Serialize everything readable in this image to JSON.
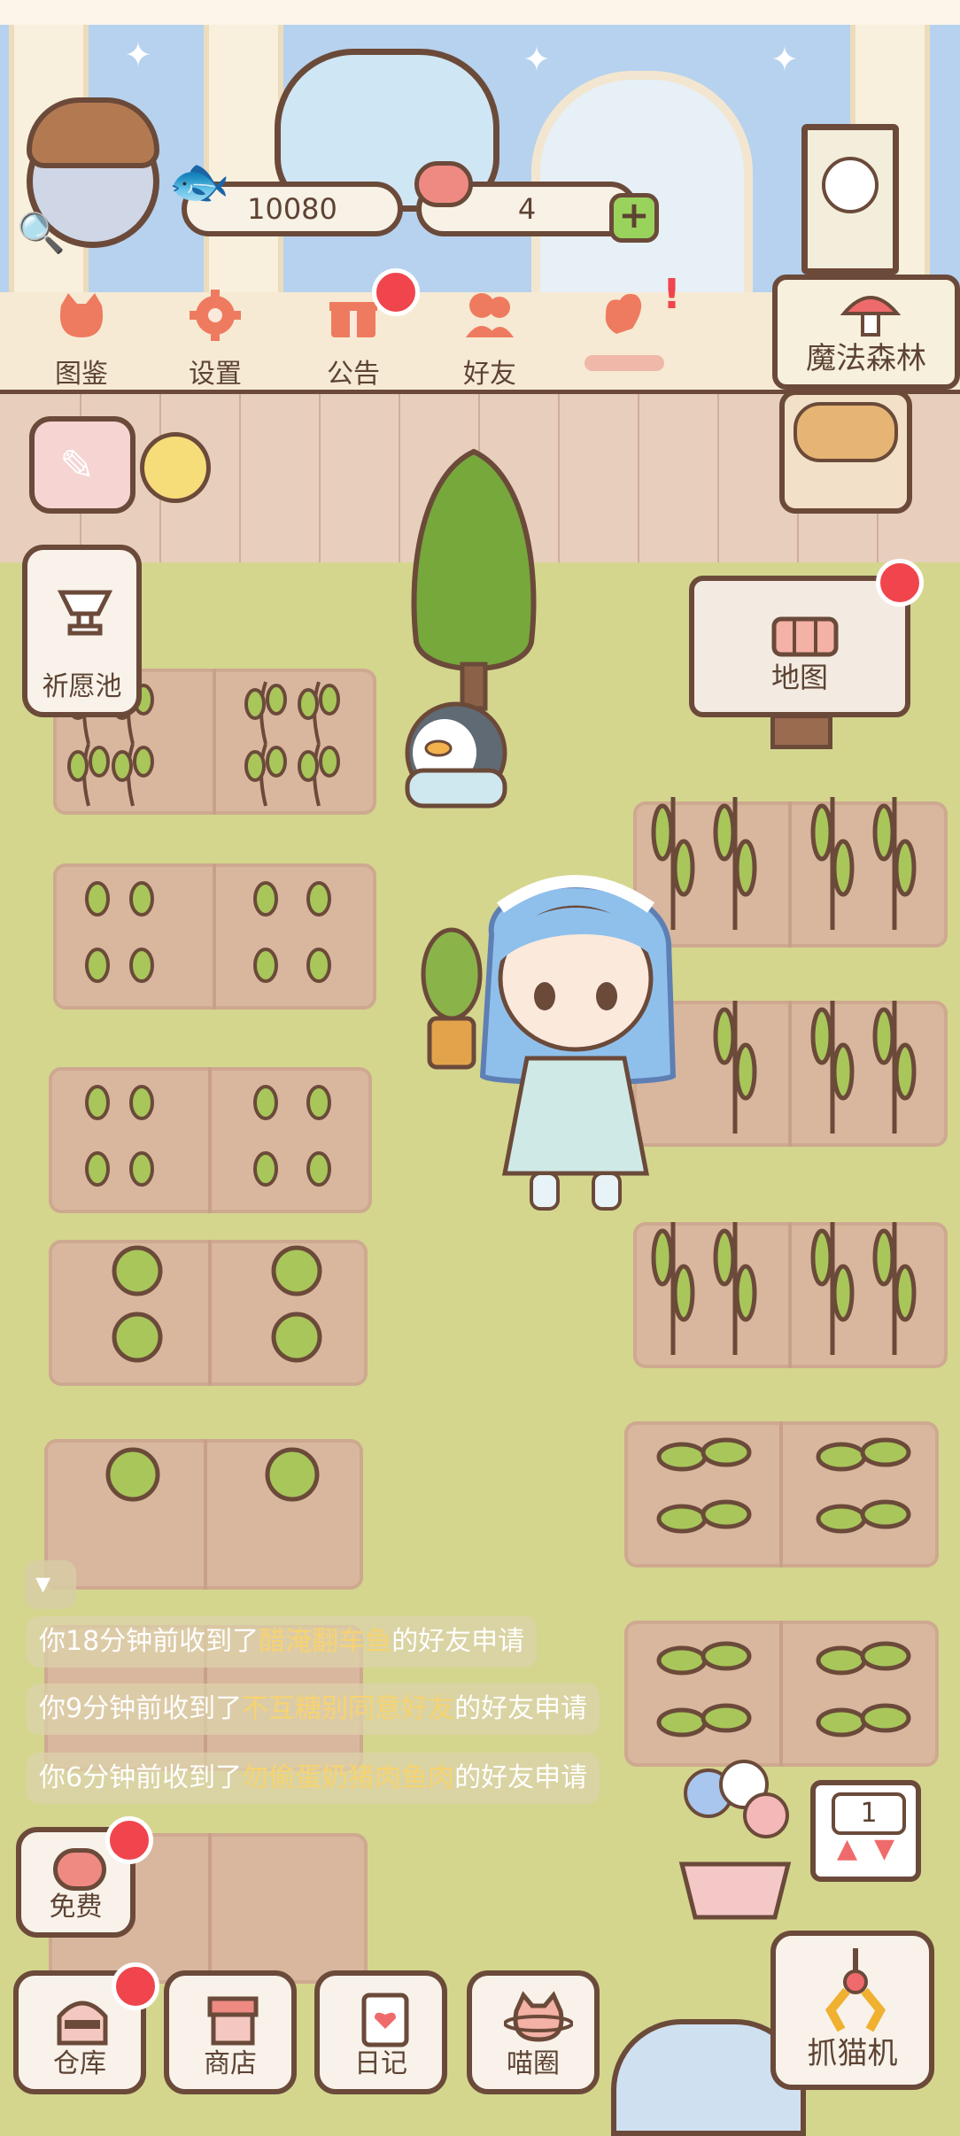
{
  "player": {
    "coins": "10080",
    "hearts": "4"
  },
  "top_menu": [
    {
      "label": "图鉴",
      "icon": "cat-book-icon"
    },
    {
      "label": "设置",
      "icon": "gear-icon"
    },
    {
      "label": "公告",
      "icon": "gift-icon"
    },
    {
      "label": "好友",
      "icon": "friends-icon"
    }
  ],
  "right_panel": {
    "forest_label": "魔法森林",
    "map_label": "地图"
  },
  "left_panel": {
    "wish_pool_label": "祈愿池"
  },
  "messages": [
    {
      "prefix": "你18分钟前收到了",
      "name": "醋淹翻车鱼",
      "suffix": "的好友申请"
    },
    {
      "prefix": "你9分钟前收到了",
      "name": "不互糖别同意好友",
      "suffix": "的好友申请"
    },
    {
      "prefix": "你6分钟前收到了",
      "name": "勿偷蛋奶猪肉鱼肉",
      "suffix": "的好友申请"
    }
  ],
  "bottom_menu": {
    "free_label": "免费",
    "warehouse_label": "仓库",
    "shop_label": "商店",
    "diary_label": "日记",
    "meow_circle_label": "喵圈",
    "claw_machine_label": "抓猫机",
    "elevator_floor": "1"
  },
  "colors": {
    "outline": "#6b4a3a",
    "grass": "#d4d68e",
    "soil": "#d9b79f",
    "badge": "#f0454d",
    "highlight_name": "#f7d36f"
  }
}
